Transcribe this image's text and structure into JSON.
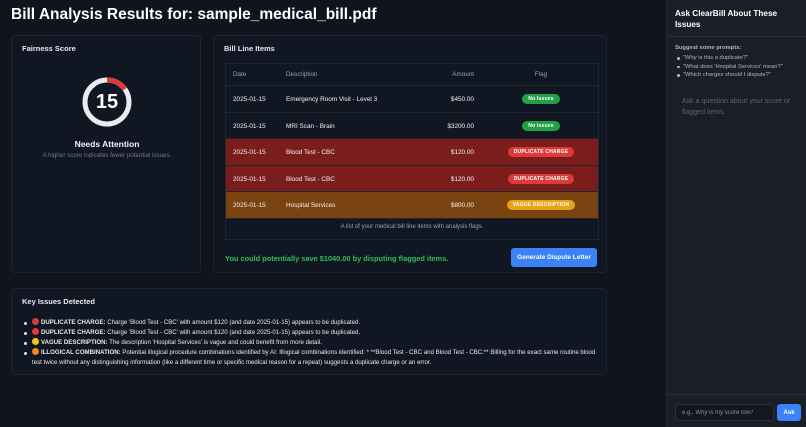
{
  "page": {
    "title": "Bill Analysis Results for: sample_medical_bill.pdf"
  },
  "fairness": {
    "title": "Fairness Score",
    "score": "15",
    "score_fraction": 0.15,
    "status": "Needs Attention",
    "description": "A higher score indicates fewer potential issues.",
    "colors": {
      "ring": "#e9ecef",
      "accent": "#dc3b3b"
    }
  },
  "line_items": {
    "title": "Bill Line Items",
    "columns": [
      "Date",
      "Description",
      "Amount",
      "Flag"
    ],
    "rows": [
      {
        "date": "2025-01-15",
        "description": "Emergency Room Visit - Level 3",
        "amount": "$450.00",
        "flag": "No Issues",
        "flag_color": "#22a047",
        "row_bg": "#111722"
      },
      {
        "date": "2025-01-15",
        "description": "MRI Scan - Brain",
        "amount": "$3200.00",
        "flag": "No Issues",
        "flag_color": "#22a047",
        "row_bg": "#111722"
      },
      {
        "date": "2025-01-15",
        "description": "Blood Test - CBC",
        "amount": "$120.00",
        "flag": "DUPLICATE CHARGE",
        "flag_color": "#dc3b3b",
        "row_bg": "#7c1d1d"
      },
      {
        "date": "2025-01-15",
        "description": "Blood Test - CBC",
        "amount": "$120.00",
        "flag": "DUPLICATE CHARGE",
        "flag_color": "#dc3b3b",
        "row_bg": "#7c1d1d"
      },
      {
        "date": "2025-01-15",
        "description": "Hospital Services",
        "amount": "$800.00",
        "flag": "VAGUE DESCRIPTION",
        "flag_color": "#e8a317",
        "row_bg": "#7a4410"
      }
    ],
    "caption": "A list of your medical bill line items with analysis flags.",
    "savings": "You could potentially save $1040.00 by disputing flagged items.",
    "dispute_button": "Generate Dispute Letter"
  },
  "issues": {
    "title": "Key Issues Detected",
    "items": [
      {
        "label": "DUPLICATE CHARGE:",
        "text": " Charge 'Blood Test - CBC' with amount $120 (and date 2025-01-15) appears to be duplicated.",
        "icon": "red-circle-icon",
        "color": "#dc3b3b"
      },
      {
        "label": "DUPLICATE CHARGE:",
        "text": " Charge 'Blood Test - CBC' with amount $120 (and date 2025-01-15) appears to be duplicated.",
        "icon": "red-circle-icon",
        "color": "#dc3b3b"
      },
      {
        "label": "VAGUE DESCRIPTION:",
        "text": " The description 'Hospital Services' is vague and could benefit from more detail.",
        "icon": "yellow-circle-icon",
        "color": "#f2c31c"
      },
      {
        "label": "ILLOGICAL COMBINATION:",
        "text": " Potential illogical procedure combinations identified by AI: Illogical combinations identified: * **Blood Test - CBC and Blood Test - CBC:** Billing for the exact same routine blood test twice without any distinguishing information (like a different time or specific medical reason for a repeat) suggests a duplicate charge or an error.",
        "icon": "orange-circle-icon",
        "color": "#f08a1c"
      }
    ]
  },
  "sidebar": {
    "title": "Ask ClearBill About These Issues",
    "suggest_label": "Suggest some prompts:",
    "prompts": [
      "\"Why is this a duplicate?\"",
      "\"What does 'Hospital Services' mean?\"",
      "\"Which charges should I dispute?\""
    ],
    "empty_text": "Ask a question about your score or flagged items.",
    "input_placeholder": "e.g., Why is my score low?",
    "ask_button": "Ask"
  }
}
